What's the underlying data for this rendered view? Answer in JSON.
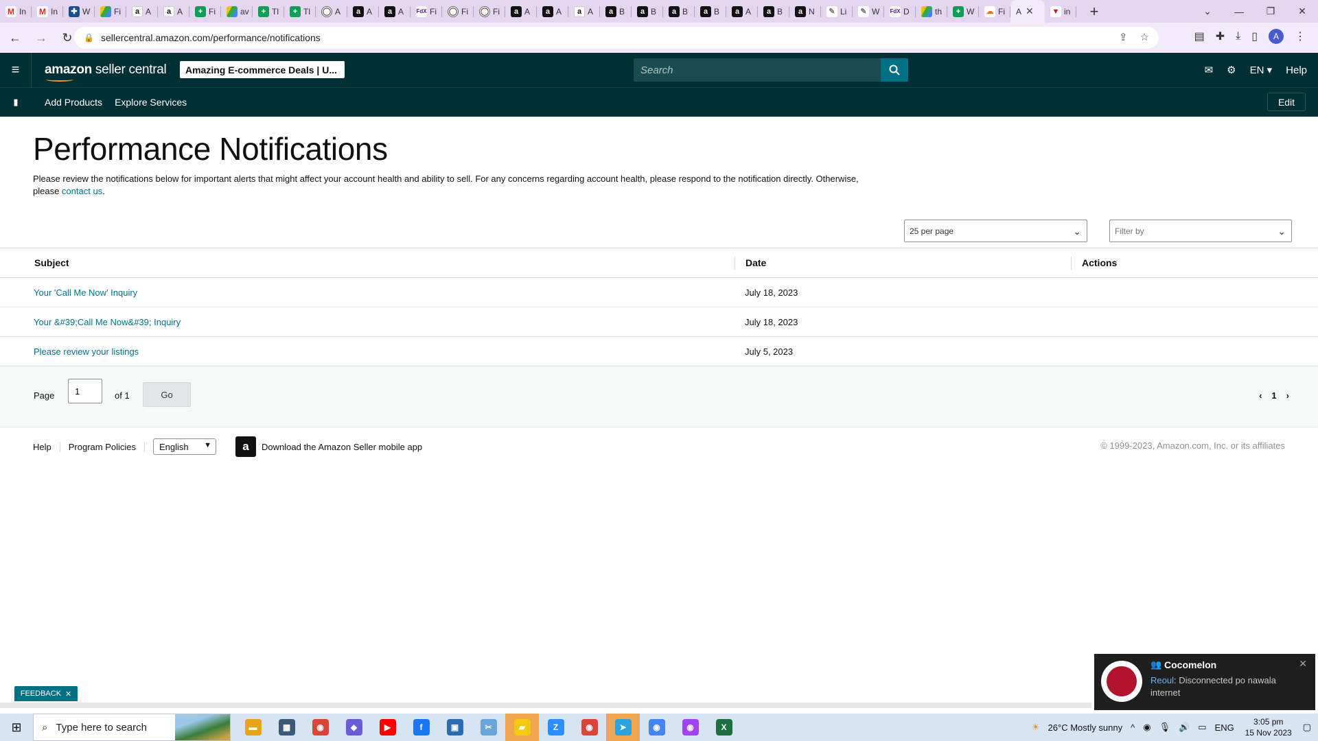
{
  "browser": {
    "tabs": [
      {
        "title": "In",
        "favicon": "gmail-icon",
        "glyph": "M",
        "cls": "gmail"
      },
      {
        "title": "In",
        "favicon": "gmail-icon",
        "glyph": "M",
        "cls": "gmail"
      },
      {
        "title": "W",
        "favicon": "puzzle-icon",
        "glyph": "✚",
        "cls": "puzzle"
      },
      {
        "title": "Fi",
        "favicon": "drive-icon",
        "glyph": "",
        "cls": "drive"
      },
      {
        "title": "A",
        "favicon": "amazon-icon",
        "glyph": "a",
        "cls": "amzw"
      },
      {
        "title": "A",
        "favicon": "amazon-icon",
        "glyph": "a",
        "cls": "amzw"
      },
      {
        "title": "Fi",
        "favicon": "sheets-icon",
        "glyph": "+",
        "cls": "sheet"
      },
      {
        "title": "av",
        "favicon": "drive-icon",
        "glyph": "",
        "cls": "drive"
      },
      {
        "title": "Tl",
        "favicon": "sheets-icon",
        "glyph": "+",
        "cls": "sheet"
      },
      {
        "title": "Tl",
        "favicon": "sheets-icon",
        "glyph": "+",
        "cls": "sheet"
      },
      {
        "title": "A",
        "favicon": "globe-icon",
        "glyph": "◯",
        "cls": "globe"
      },
      {
        "title": "A",
        "favicon": "amazon-icon",
        "glyph": "a",
        "cls": "amz"
      },
      {
        "title": "A",
        "favicon": "amazon-icon",
        "glyph": "a",
        "cls": "amz"
      },
      {
        "title": "Fi",
        "favicon": "fedex-icon",
        "glyph": "FdX",
        "cls": "fedex"
      },
      {
        "title": "Fi",
        "favicon": "globe-icon",
        "glyph": "◯",
        "cls": "globe"
      },
      {
        "title": "Fi",
        "favicon": "globe-icon",
        "glyph": "◯",
        "cls": "globe"
      },
      {
        "title": "A",
        "favicon": "amazon-icon",
        "glyph": "a",
        "cls": "amz"
      },
      {
        "title": "A",
        "favicon": "amazon-icon",
        "glyph": "a",
        "cls": "amz"
      },
      {
        "title": "A",
        "favicon": "amazon-icon",
        "glyph": "a",
        "cls": "amzw"
      },
      {
        "title": "B",
        "favicon": "amazon-icon",
        "glyph": "a",
        "cls": "amz"
      },
      {
        "title": "B",
        "favicon": "amazon-icon",
        "glyph": "a",
        "cls": "amz"
      },
      {
        "title": "B",
        "favicon": "amazon-icon",
        "glyph": "a",
        "cls": "amz"
      },
      {
        "title": "B",
        "favicon": "amazon-icon",
        "glyph": "a",
        "cls": "amz"
      },
      {
        "title": "A",
        "favicon": "amazon-icon",
        "glyph": "a",
        "cls": "amz"
      },
      {
        "title": "B",
        "favicon": "amazon-icon",
        "glyph": "a",
        "cls": "amz"
      },
      {
        "title": "N",
        "favicon": "amazon-icon",
        "glyph": "a",
        "cls": "amz"
      },
      {
        "title": "Li",
        "favicon": "pen-icon",
        "glyph": "✎",
        "cls": "pen"
      },
      {
        "title": "W",
        "favicon": "pen-icon",
        "glyph": "✎",
        "cls": "pen"
      },
      {
        "title": "D",
        "favicon": "fedex-icon",
        "glyph": "FdX",
        "cls": "fedex"
      },
      {
        "title": "th",
        "favicon": "drive-icon",
        "glyph": "",
        "cls": "drive"
      },
      {
        "title": "W",
        "favicon": "sheets-icon",
        "glyph": "+",
        "cls": "sheet"
      },
      {
        "title": "Fi",
        "favicon": "cloud-icon",
        "glyph": "☁",
        "cls": "cloud"
      }
    ],
    "active_tab": {
      "title": "A"
    },
    "last_tab": {
      "title": "in",
      "favicon": "red-v-icon",
      "glyph": "▼",
      "cls": "red"
    },
    "url": "sellercentral.amazon.com/performance/notifications"
  },
  "header": {
    "brand_bold": "amazon",
    "brand_rest": " seller central",
    "store_name": "Amazing E-commerce Deals | U...",
    "search_placeholder": "Search",
    "language": "EN",
    "help": "Help"
  },
  "subnav": {
    "links": [
      "Add Products",
      "Explore Services"
    ],
    "edit": "Edit"
  },
  "page": {
    "title": "Performance Notifications",
    "intro_text": "Please review the notifications below for important alerts that might affect your account health and ability to sell. For any concerns regarding account health, please respond to the notification directly. Otherwise, please ",
    "intro_link": "contact us",
    "intro_end": "."
  },
  "controls": {
    "per_page": "25 per page",
    "filter_placeholder": "Filter by"
  },
  "table": {
    "columns": [
      "Subject",
      "Date",
      "Actions"
    ],
    "rows": [
      {
        "subject": "Your 'Call Me Now' Inquiry",
        "date": "July 18, 2023"
      },
      {
        "subject": "Your &#39;Call Me Now&#39; Inquiry",
        "date": "July 18, 2023"
      },
      {
        "subject": "Please review your listings",
        "date": "July 5, 2023"
      }
    ]
  },
  "pagination": {
    "page_label": "Page",
    "page_value": "1",
    "of_label": "of 1",
    "go": "Go",
    "current": "1"
  },
  "footer": {
    "links": [
      "Help",
      "Program Policies"
    ],
    "language": "English",
    "app_text": "Download the Amazon Seller mobile app",
    "copyright": "© 1999-2023, Amazon.com, Inc. or its affiliates"
  },
  "feedback": {
    "label": "FEEDBACK"
  },
  "toast": {
    "title": "Cocomelon",
    "sender": "Reoul",
    "message": ": Disconnected po nawala internet"
  },
  "taskbar": {
    "search_placeholder": "Type here to search",
    "weather": "26°C  Mostly sunny",
    "lang": "ENG",
    "time": "3:05 pm",
    "date": "15 Nov 2023",
    "apps": [
      {
        "name": "file-explorer-icon",
        "color": "#e8a317",
        "glyph": "▬"
      },
      {
        "name": "calculator-icon",
        "color": "#3a5a7a",
        "glyph": "▦"
      },
      {
        "name": "chrome-icon",
        "color": "#db4437",
        "glyph": "◉"
      },
      {
        "name": "copilot-icon",
        "color": "#6b5bd6",
        "glyph": "◆"
      },
      {
        "name": "youtube-icon",
        "color": "#ff0000",
        "glyph": "▶"
      },
      {
        "name": "facebook-icon",
        "color": "#1877f2",
        "glyph": "f"
      },
      {
        "name": "store-icon",
        "color": "#2b6cb0",
        "glyph": "▣"
      },
      {
        "name": "snipping-icon",
        "color": "#6aa7d8",
        "glyph": "✂"
      },
      {
        "name": "sticky-notes-icon",
        "color": "#f2c811",
        "glyph": "▰"
      },
      {
        "name": "zoom-icon",
        "color": "#2d8cff",
        "glyph": "Z"
      },
      {
        "name": "chrome-profile-icon",
        "color": "#db4437",
        "glyph": "◉"
      },
      {
        "name": "telegram-icon",
        "color": "#2aa3df",
        "glyph": "➤"
      },
      {
        "name": "chrome-profile-icon",
        "color": "#4285f4",
        "glyph": "◉"
      },
      {
        "name": "chrome-profile-icon",
        "color": "#a142f4",
        "glyph": "◉"
      },
      {
        "name": "excel-icon",
        "color": "#1d6f42",
        "glyph": "X"
      }
    ]
  }
}
